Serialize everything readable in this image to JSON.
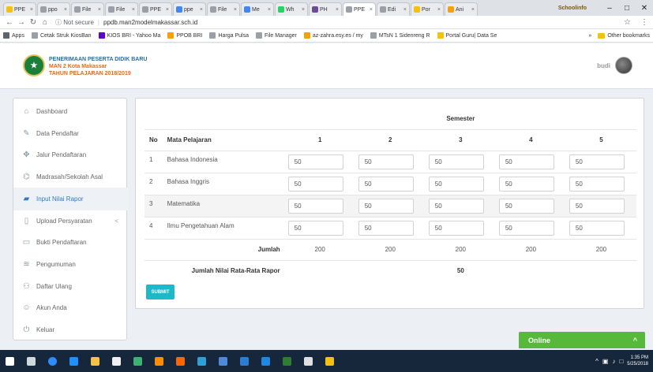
{
  "browser": {
    "tabs": [
      {
        "label": "PPE",
        "color": "#f4c20d"
      },
      {
        "label": "ppo",
        "color": "#9aa0a6"
      },
      {
        "label": "File",
        "color": "#9aa0a6"
      },
      {
        "label": "File",
        "color": "#9aa0a6"
      },
      {
        "label": "PPE",
        "color": "#9aa0a6"
      },
      {
        "label": "ppe",
        "color": "#4285f4"
      },
      {
        "label": "File",
        "color": "#9aa0a6"
      },
      {
        "label": "Me",
        "color": "#4285f4"
      },
      {
        "label": "Wh",
        "color": "#25d366"
      },
      {
        "label": "PH",
        "color": "#6a4c93"
      },
      {
        "label": "PPE",
        "color": "#9aa0a6",
        "active": true
      },
      {
        "label": "Edi",
        "color": "#9aa0a6"
      },
      {
        "label": "Por",
        "color": "#f4c20d"
      },
      {
        "label": "Ani",
        "color": "#f4a10d"
      }
    ],
    "profile": "Schoolinfo",
    "url_security": "Not secure",
    "url": "ppdb.man2modelmakassar.sch.id",
    "bookmarks": [
      {
        "label": "Apps",
        "color": "#5f6368"
      },
      {
        "label": "Cetak Struk KiosBan",
        "color": "#9aa0a6"
      },
      {
        "label": "KIOS BRI - Yahoo Ma",
        "color": "#6001d2"
      },
      {
        "label": "PPOB BRI",
        "color": "#f4a10d"
      },
      {
        "label": "Harga Pulsa",
        "color": "#9aa0a6"
      },
      {
        "label": "File Manager",
        "color": "#9aa0a6"
      },
      {
        "label": "az-zahra.esy.es / my",
        "color": "#f4a10d"
      },
      {
        "label": "MTsN 1 Sidenreng R",
        "color": "#9aa0a6"
      },
      {
        "label": "Portal Guru| Data Se",
        "color": "#f4c20d"
      }
    ],
    "bookmarks_more": "»",
    "other_bookmarks": "Other bookmarks"
  },
  "header": {
    "line1": "PENERIMAAN PESERTA DIDIK BARU",
    "line2": "MAN 2 Kota Makassar",
    "line3": "TAHUN PELAJARAN 2018/2019",
    "username": "budi"
  },
  "sidebar": {
    "items": [
      {
        "label": "Dashboard",
        "icon": "home-icon"
      },
      {
        "label": "Data Pendaftar",
        "icon": "edit-icon"
      },
      {
        "label": "Jalur Pendaftaran",
        "icon": "move-icon"
      },
      {
        "label": "Madrasah/Sekolah Asal",
        "icon": "graduation-cap-icon"
      },
      {
        "label": "Input Nilai Rapor",
        "icon": "book-icon",
        "active": true
      },
      {
        "label": "Upload Persyaratan",
        "icon": "file-icon",
        "chevron": "<"
      },
      {
        "label": "Bukti Pendaftaran",
        "icon": "document-icon"
      },
      {
        "label": "Pengumuman",
        "icon": "database-icon"
      },
      {
        "label": "Daftar Ulang",
        "icon": "users-icon"
      },
      {
        "label": "Akun Anda",
        "icon": "user-icon"
      },
      {
        "label": "Keluar",
        "icon": "power-icon"
      }
    ]
  },
  "table": {
    "semester_header": "Semester",
    "col_no": "No",
    "col_subject": "Mata Pelajaran",
    "semesters": [
      "1",
      "2",
      "3",
      "4",
      "5"
    ],
    "rows": [
      {
        "no": "1",
        "subject": "Bahasa Indonesia",
        "values": [
          "50",
          "50",
          "50",
          "50",
          "50"
        ]
      },
      {
        "no": "2",
        "subject": "Bahasa Inggris",
        "values": [
          "50",
          "50",
          "50",
          "50",
          "50"
        ]
      },
      {
        "no": "3",
        "subject": "Matematika",
        "values": [
          "50",
          "50",
          "50",
          "50",
          "50"
        ]
      },
      {
        "no": "4",
        "subject": "Ilmu Pengetahuan Alam",
        "values": [
          "50",
          "50",
          "50",
          "50",
          "50"
        ]
      }
    ],
    "total_label": "Jumlah",
    "totals": [
      "200",
      "200",
      "200",
      "200",
      "200"
    ],
    "avg_label": "Jumlah Nilai Rata-Rata Rapor",
    "avg_value": "50"
  },
  "submit_label": "SUBMIT",
  "chat": {
    "label": "Online"
  },
  "taskbar": {
    "apps": [
      "#ffffff",
      "#cfd8dc",
      "#2d8cff",
      "#1e90ff",
      "#f5c242",
      "#f0f0f0",
      "#3cb371",
      "#ff8c00",
      "#ff6600",
      "#2f9fd8",
      "#4d8bd9",
      "#2d7dd2",
      "#1e88e5",
      "#2e7d32",
      "#e0e0e0",
      "#f4c20d"
    ],
    "time": "1:35 PM",
    "date": "5/25/2018"
  }
}
